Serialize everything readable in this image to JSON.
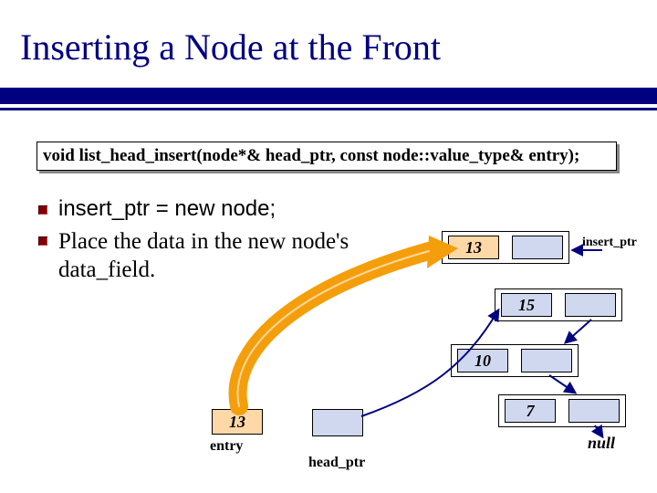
{
  "title": "Inserting a Node at the Front",
  "code_signature": "void list_head_insert(node*& head_ptr, const node::value_type& entry);",
  "bullets": {
    "b1": "insert_ptr = new node;",
    "b2": "Place the data in the new node's data_field."
  },
  "new_node": {
    "data": "13",
    "label": "insert_ptr"
  },
  "list": {
    "n1": "15",
    "n2": "10",
    "n3": "7",
    "terminator": "null"
  },
  "entry": {
    "value": "13",
    "label": "entry"
  },
  "head_ptr_label": "head_ptr"
}
